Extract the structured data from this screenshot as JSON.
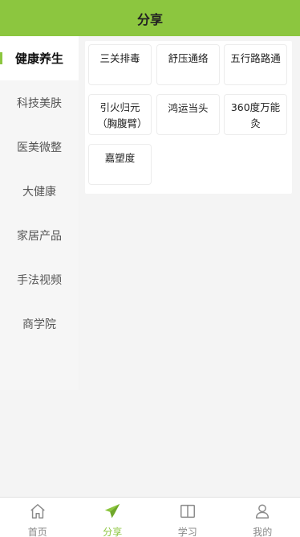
{
  "header": {
    "title": "分享"
  },
  "sidebar": {
    "items": [
      {
        "label": "健康养生"
      },
      {
        "label": "科技美肤"
      },
      {
        "label": "医美微整"
      },
      {
        "label": "大健康"
      },
      {
        "label": "家居产品"
      },
      {
        "label": "手法视频"
      },
      {
        "label": "商学院"
      }
    ]
  },
  "content": {
    "items": [
      {
        "label": "三关排毒"
      },
      {
        "label": "舒压通络"
      },
      {
        "label": "五行路路通"
      },
      {
        "label": "引火归元（胸腹臂）"
      },
      {
        "label": "鸿运当头"
      },
      {
        "label": "360度万能灸"
      },
      {
        "label": "嘉塑度"
      }
    ]
  },
  "tabbar": {
    "items": [
      {
        "label": "首页",
        "icon": "home-icon"
      },
      {
        "label": "分享",
        "icon": "paper-plane-icon"
      },
      {
        "label": "学习",
        "icon": "book-icon"
      },
      {
        "label": "我的",
        "icon": "user-icon"
      }
    ]
  },
  "colors": {
    "accent": "#8cc63f",
    "inactive": "#888888"
  }
}
